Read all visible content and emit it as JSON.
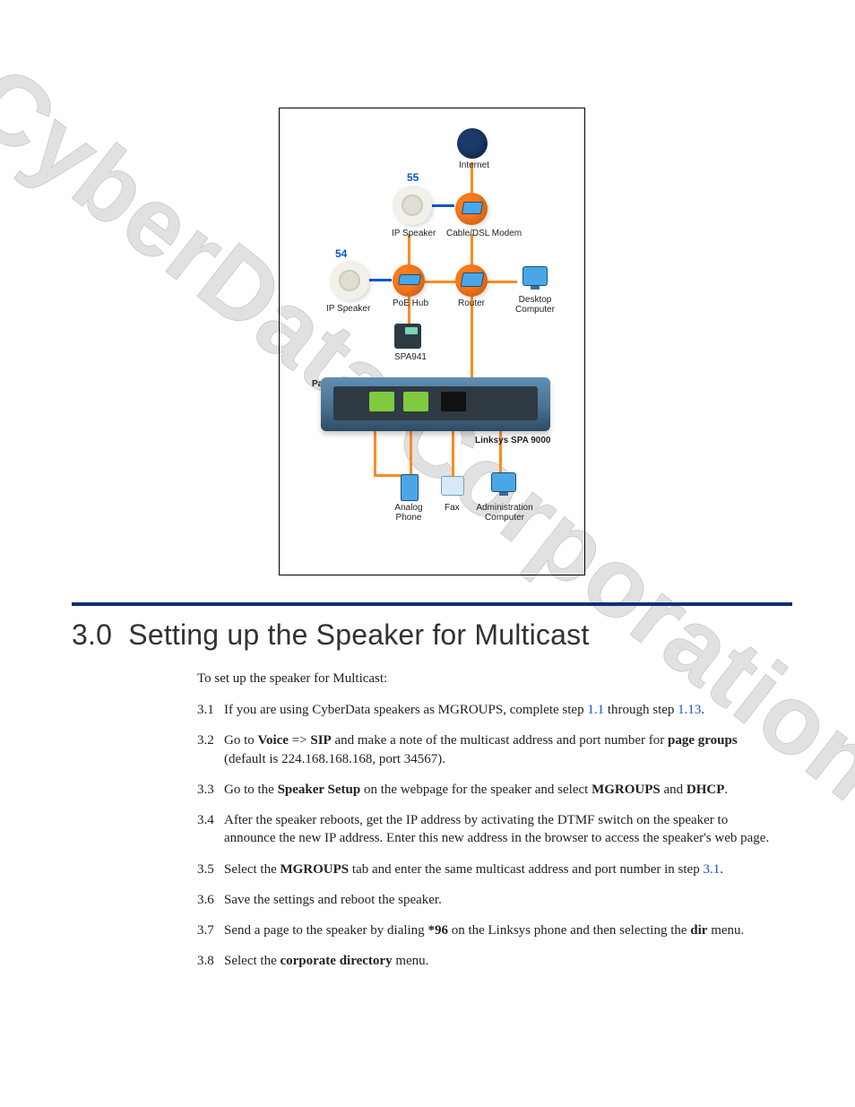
{
  "watermark": "CyberData Corporation",
  "diagram": {
    "callouts": {
      "c54": "54",
      "c55": "55"
    },
    "nodes": {
      "internet": "Internet",
      "cable_modem": "Cable/DSL Modem",
      "ip_speaker_top": "IP Speaker",
      "ip_speaker_left": "IP Speaker",
      "poe_hub": "PoE Hub",
      "router": "Router",
      "desktop_computer": "Desktop\nComputer",
      "spa941": "SPA941",
      "paging_server": "Paging Server",
      "linksys_spa9000": "Linksys SPA 9000",
      "analog_phone": "Analog\nPhone",
      "fax": "Fax",
      "admin_computer": "Administration\nComputer"
    }
  },
  "section": {
    "number": "3.0",
    "title": "Setting up the Speaker for Multicast",
    "intro": "To set up the speaker for Multicast:",
    "steps": [
      {
        "num": "3.1",
        "html": "If you are using CyberData speakers as MGROUPS, complete step <span class='link' data-name='xref-link' data-interactable='true'>1.1</span> through step <span class='link' data-name='xref-link' data-interactable='true'>1.13</span>."
      },
      {
        "num": "3.2",
        "html": "Go to <b>Voice</b> =&gt; <b>SIP</b> and make a note of the multicast address and port number for <b>page groups</b> (default is 224.168.168.168, port 34567)."
      },
      {
        "num": "3.3",
        "html": "Go to the <b>Speaker Setup</b> on the webpage for the speaker and select <b>MGROUPS</b> and <b>DHCP</b>."
      },
      {
        "num": "3.4",
        "html": "After the speaker reboots, get the IP address by activating the DTMF switch on the speaker to announce the new IP address. Enter this new address in the browser to access the speaker's web page."
      },
      {
        "num": "3.5",
        "html": "Select the <b>MGROUPS</b> tab and enter the same multicast address and port number in step <span class='link' data-name='xref-link' data-interactable='true'>3.1</span>."
      },
      {
        "num": "3.6",
        "html": "Save the settings and reboot the speaker."
      },
      {
        "num": "3.7",
        "html": "Send a page to the speaker by dialing <b>*96</b> on the Linksys phone and then selecting the <b>dir</b> menu."
      },
      {
        "num": "3.8",
        "html": "Select the <b>corporate directory</b> menu."
      }
    ]
  }
}
